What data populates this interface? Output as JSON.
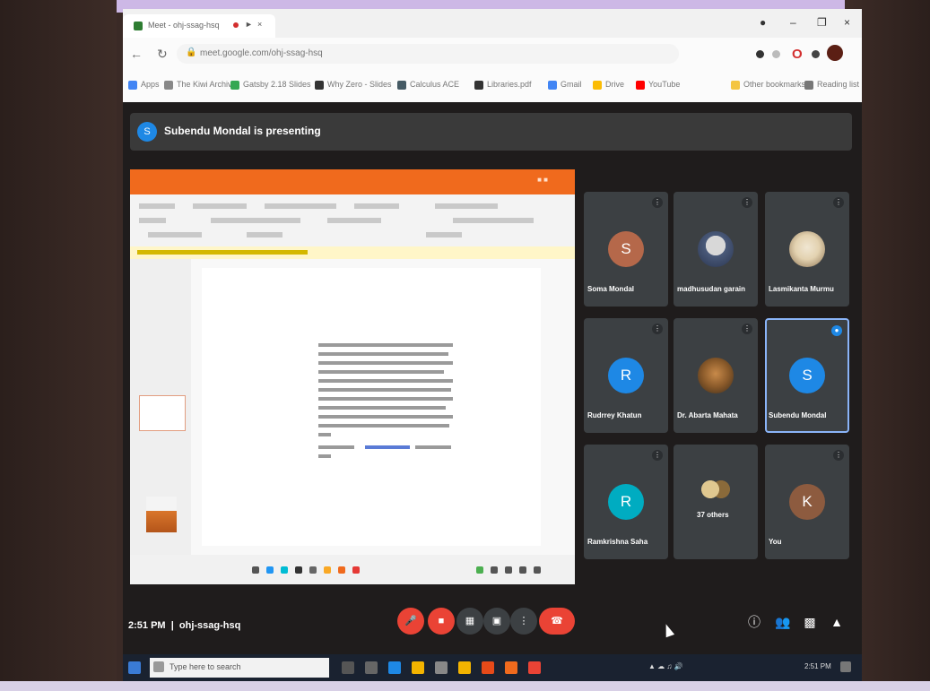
{
  "browser": {
    "tab_title": "Meet - ohj-ssag-hsq",
    "url": "meet.google.com/ohj-ssag-hsq",
    "bookmarks": [
      {
        "label": "Apps"
      },
      {
        "label": "The Kiwi Archive"
      },
      {
        "label": "Gatsby 2.18 Slides"
      },
      {
        "label": "Why Zero - Slides"
      },
      {
        "label": "Calculus ACE"
      },
      {
        "label": "Libraries.pdf"
      },
      {
        "label": "Gmail"
      },
      {
        "label": "Drive"
      },
      {
        "label": "YouTube"
      },
      {
        "label": "Other bookmarks"
      },
      {
        "label": "Reading list"
      }
    ]
  },
  "meet": {
    "presenting_banner": "Subendu Mondal is presenting",
    "meeting_time": "2:51 PM",
    "meeting_code": "ohj-ssag-hsq",
    "participants": [
      {
        "name": "Soma Mondal",
        "initial": "S",
        "avatar_color": "#b5684a",
        "type": "initial"
      },
      {
        "name": "madhusudan garain",
        "initial": "",
        "avatar_color": "#5a6a7e",
        "type": "photo"
      },
      {
        "name": "Lasmikanta Murmu",
        "initial": "",
        "avatar_color": "#c9b48f",
        "type": "photo"
      },
      {
        "name": "Rudrrey Khatun",
        "initial": "R",
        "avatar_color": "#1e88e5",
        "type": "initial"
      },
      {
        "name": "Dr. Abarta Mahata",
        "initial": "",
        "avatar_color": "#6b4a2e",
        "type": "photo"
      },
      {
        "name": "Subendu Mondal",
        "initial": "S",
        "avatar_color": "#1e88e5",
        "type": "initial",
        "active": true
      },
      {
        "name": "Ramkrishna Saha",
        "initial": "R",
        "avatar_color": "#00acc1",
        "type": "initial"
      },
      {
        "name": "37 others",
        "initial": "",
        "avatar_color": "#8a6a3a",
        "type": "group"
      },
      {
        "name": "You",
        "initial": "K",
        "avatar_color": "#8d5b3f",
        "type": "initial"
      }
    ]
  },
  "taskbar": {
    "search_placeholder": "Type here to search",
    "clock": "2:51 PM"
  },
  "colors": {
    "powerpoint_orange": "#f06a1d",
    "end_call_red": "#ea4335",
    "meet_bg": "#1f1c1c",
    "tile_bg": "#3c4043"
  }
}
